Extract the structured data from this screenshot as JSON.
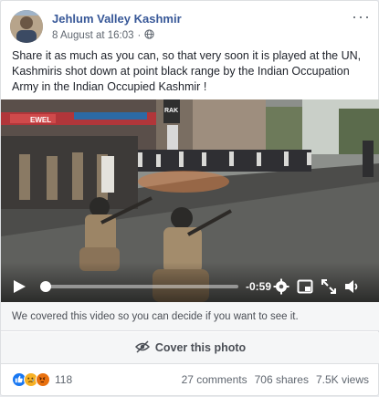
{
  "post": {
    "page_name": "Jehlum Valley Kashmir",
    "timestamp": "8 August at 16:03",
    "separator": "·",
    "privacy_icon": "globe-icon",
    "more_label": "···",
    "text": "Share it as much as you can, so that very soon it is played at the UN, Kashmiris shot down at point black range by the Indian Occupation Army in the Indian Occupied Kashmir !"
  },
  "video": {
    "signs": {
      "ewel": "EWEL",
      "rak": "RAK"
    },
    "time_remaining": "-0:59",
    "progress": 0.0,
    "controls": [
      "play-icon",
      "settings-icon",
      "pip-icon",
      "fullscreen-icon",
      "volume-icon"
    ]
  },
  "cover": {
    "note": "We covered this video so you can decide if you want to see it.",
    "button_label": "Cover this photo",
    "button_icon": "eye-slash-icon"
  },
  "engagement": {
    "reaction_icons": [
      "like-icon",
      "sad-icon",
      "angry-icon"
    ],
    "reaction_count": "118",
    "comments": "27 comments",
    "shares": "706 shares",
    "views": "7.5K views"
  },
  "colors": {
    "link": "#385898",
    "like": "#1877f2",
    "sad": "#f7b125",
    "angry": "#e9710f"
  }
}
